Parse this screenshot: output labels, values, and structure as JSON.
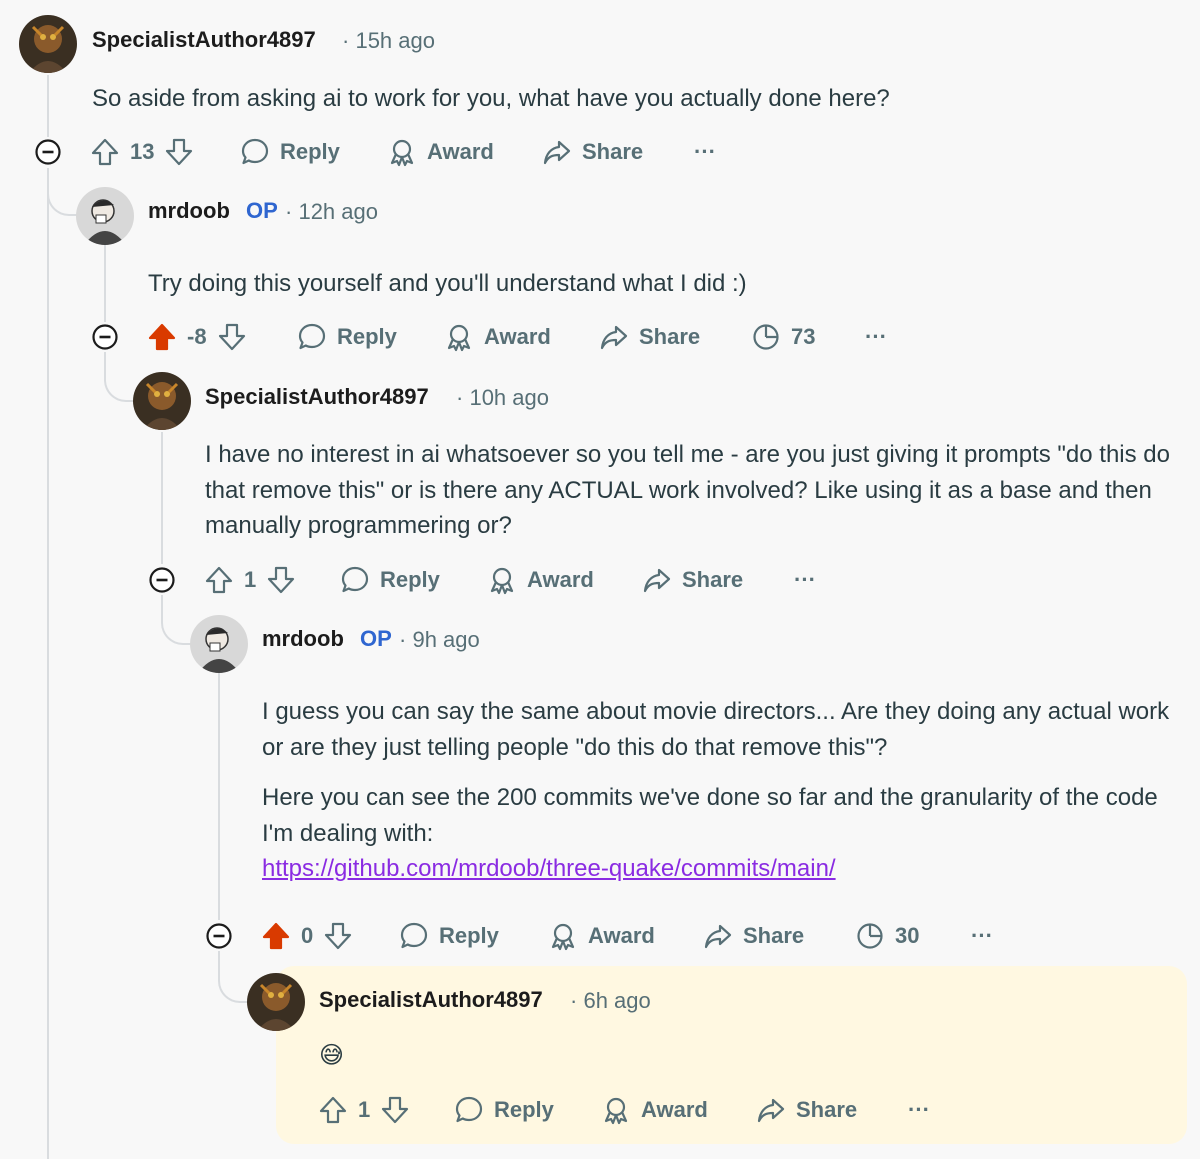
{
  "colors": {
    "upvoted": "#d93a00",
    "op_badge": "#2f66d0",
    "link": "#8a2be2",
    "highlight": "#fff8e1",
    "text_muted": "#576f76"
  },
  "labels": {
    "reply": "Reply",
    "award": "Award",
    "share": "Share",
    "more": "···",
    "op": "OP"
  },
  "icons": [
    "collapse-icon",
    "upvote-icon",
    "downvote-icon",
    "reply-icon",
    "award-icon",
    "share-icon",
    "insights-icon",
    "more-icon"
  ],
  "comments": [
    {
      "author": "SpecialistAuthor4897",
      "time": "15h ago",
      "body": [
        "So aside from asking ai to work for you, what have you actually done here?"
      ],
      "score": "13",
      "upvoted": false
    },
    {
      "author": "mrdoob",
      "op": true,
      "time": "12h ago",
      "body": [
        "Try doing this yourself and you'll understand what I did :)"
      ],
      "score": "-8",
      "upvoted": true,
      "views": "73"
    },
    {
      "author": "SpecialistAuthor4897",
      "time": "10h ago",
      "body": [
        "I have no interest in ai whatsoever so you tell me - are you just giving it prompts \"do this do that remove this\" or is there any ACTUAL work involved? Like using it as a base and then manually programmering or?"
      ],
      "score": "1",
      "upvoted": false
    },
    {
      "author": "mrdoob",
      "op": true,
      "time": "9h ago",
      "body": [
        "I guess you can say the same about movie directors... Are they doing any actual work or are they just telling people \"do this do that remove this\"?",
        "Here you can see the 200 commits we've done so far and the granularity of the code I'm dealing with:"
      ],
      "link": "https://github.com/mrdoob/three-quake/commits/main/",
      "score": "0",
      "upvoted": true,
      "views": "30"
    },
    {
      "author": "SpecialistAuthor4897",
      "time": "6h ago",
      "body": [
        "😅"
      ],
      "score": "1",
      "upvoted": false,
      "highlighted": true
    }
  ]
}
